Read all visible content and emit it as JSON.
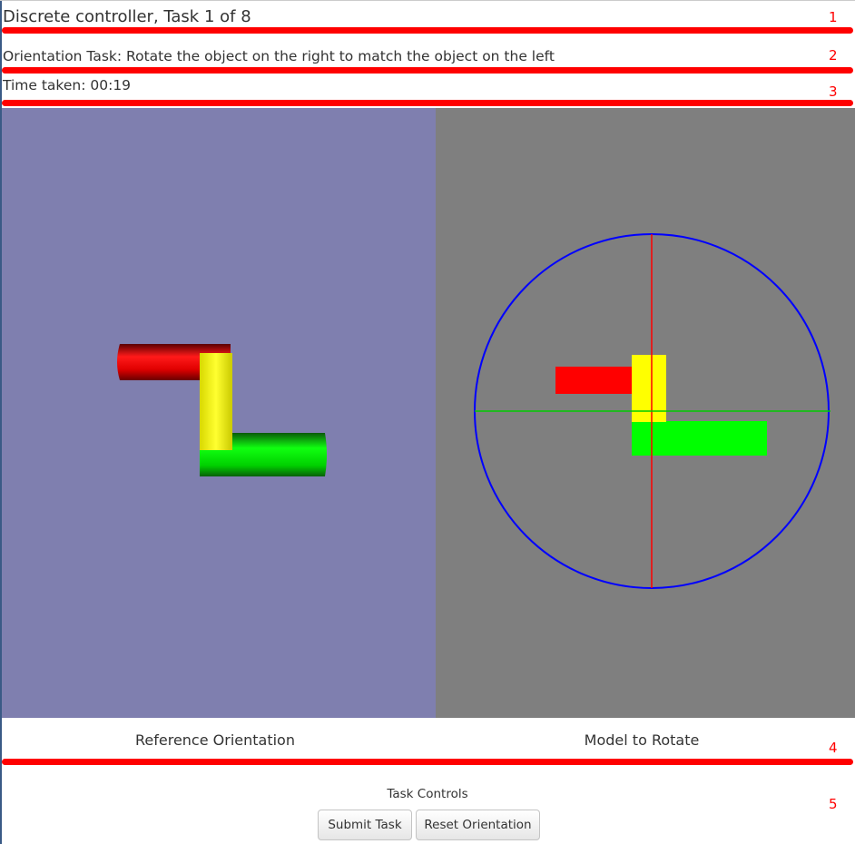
{
  "header": {
    "title": "Discrete controller, Task 1 of 8",
    "instructions": "Orientation Task: Rotate the object on the right to match the object on the left",
    "timer": "Time taken: 00:19"
  },
  "annotations": [
    "1",
    "2",
    "3",
    "4",
    "5"
  ],
  "panels": {
    "reference": {
      "label": "Reference Orientation",
      "background": "#7f7faf"
    },
    "model": {
      "label": "Model to Rotate",
      "background": "#7f7f7f"
    }
  },
  "object_colors": {
    "segment_a": "#ff0000",
    "segment_b": "#ffff00",
    "segment_c": "#00ff00"
  },
  "gizmo_colors": {
    "ring": "#0000ff",
    "vertical_axis": "#ff0000",
    "horizontal_axis": "#00cc00"
  },
  "controls": {
    "title": "Task Controls",
    "submit_label": "Submit Task",
    "reset_label": "Reset Orientation"
  },
  "annotation_color": "#ff0000"
}
